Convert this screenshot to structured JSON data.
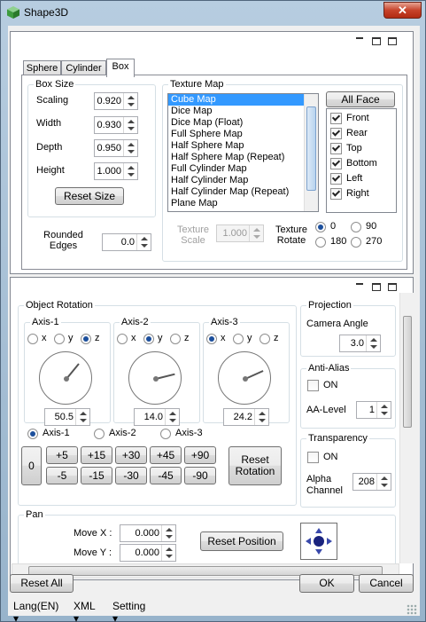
{
  "window": {
    "title": "Shape3D",
    "close_glyph": "✕"
  },
  "tabs": [
    "Sphere",
    "Cylinder",
    "Box"
  ],
  "box_size": {
    "label": "Box Size",
    "scaling_label": "Scaling",
    "scaling": "0.920",
    "width_label": "Width",
    "width": "0.930",
    "depth_label": "Depth",
    "depth": "0.950",
    "height_label": "Height",
    "height": "1.000",
    "reset_label": "Reset Size"
  },
  "rounded_edges": {
    "label_line1": "Rounded",
    "label_line2": "Edges",
    "value": "0.0"
  },
  "texture_map": {
    "label": "Texture Map",
    "items": [
      "Cube Map",
      "Dice Map",
      "Dice Map (Float)",
      "Full Sphere Map",
      "Half Sphere Map",
      "Half Sphere Map (Repeat)",
      "Full Cylinder Map",
      "Half Cylinder Map",
      "Half Cylinder Map (Repeat)",
      "Plane Map"
    ],
    "selected": "Cube Map",
    "scale_label_1": "Texture",
    "scale_label_2": "Scale",
    "scale_value": "1.000",
    "rotate_label_1": "Texture",
    "rotate_label_2": "Rotate",
    "rotate_options": [
      "0",
      "90",
      "180",
      "270"
    ],
    "rotate_selected": "0"
  },
  "faces": {
    "all_face_label": "All Face",
    "items": [
      {
        "label": "Front",
        "checked": true
      },
      {
        "label": "Rear",
        "checked": true
      },
      {
        "label": "Top",
        "checked": true
      },
      {
        "label": "Bottom",
        "checked": true
      },
      {
        "label": "Left",
        "checked": true
      },
      {
        "label": "Right",
        "checked": true
      }
    ]
  },
  "object_rotation": {
    "label": "Object Rotation",
    "axes": [
      {
        "name": "Axis-1",
        "selected": "z",
        "value": "50.5",
        "angle_deg": 50.5
      },
      {
        "name": "Axis-2",
        "selected": "y",
        "value": "14.0",
        "angle_deg": 14.0
      },
      {
        "name": "Axis-3",
        "selected": "x",
        "value": "24.2",
        "angle_deg": 24.2
      }
    ],
    "axis_letters": [
      "x",
      "y",
      "z"
    ],
    "active_axis_options": [
      "Axis-1",
      "Axis-2",
      "Axis-3"
    ],
    "active_axis": "Axis-1",
    "zero_label": "0",
    "plus_steps": [
      "+5",
      "+15",
      "+30",
      "+45",
      "+90"
    ],
    "minus_steps": [
      "-5",
      "-15",
      "-30",
      "-45",
      "-90"
    ],
    "reset_line1": "Reset",
    "reset_line2": "Rotation"
  },
  "projection": {
    "label": "Projection",
    "camera_label": "Camera Angle",
    "camera_value": "3.0"
  },
  "anti_alias": {
    "label": "Anti-Alias",
    "on_label": "ON",
    "on": false,
    "level_label": "AA-Level",
    "level": "1"
  },
  "transparency": {
    "label": "Transparency",
    "on_label": "ON",
    "on": false,
    "alpha_label_1": "Alpha",
    "alpha_label_2": "Channel",
    "alpha": "208"
  },
  "pan": {
    "label": "Pan",
    "movex_label": "Move X :",
    "movex": "0.000",
    "movey_label": "Move Y :",
    "movey": "0.000",
    "reset_label": "Reset Position"
  },
  "footer": {
    "reset_all": "Reset All",
    "ok": "OK",
    "cancel": "Cancel"
  },
  "menu": [
    "Lang(EN) ▾",
    "XML ▾",
    "Setting ▾"
  ],
  "colors": {
    "selection": "#3399ff",
    "nav_pad": "#1a237e"
  }
}
